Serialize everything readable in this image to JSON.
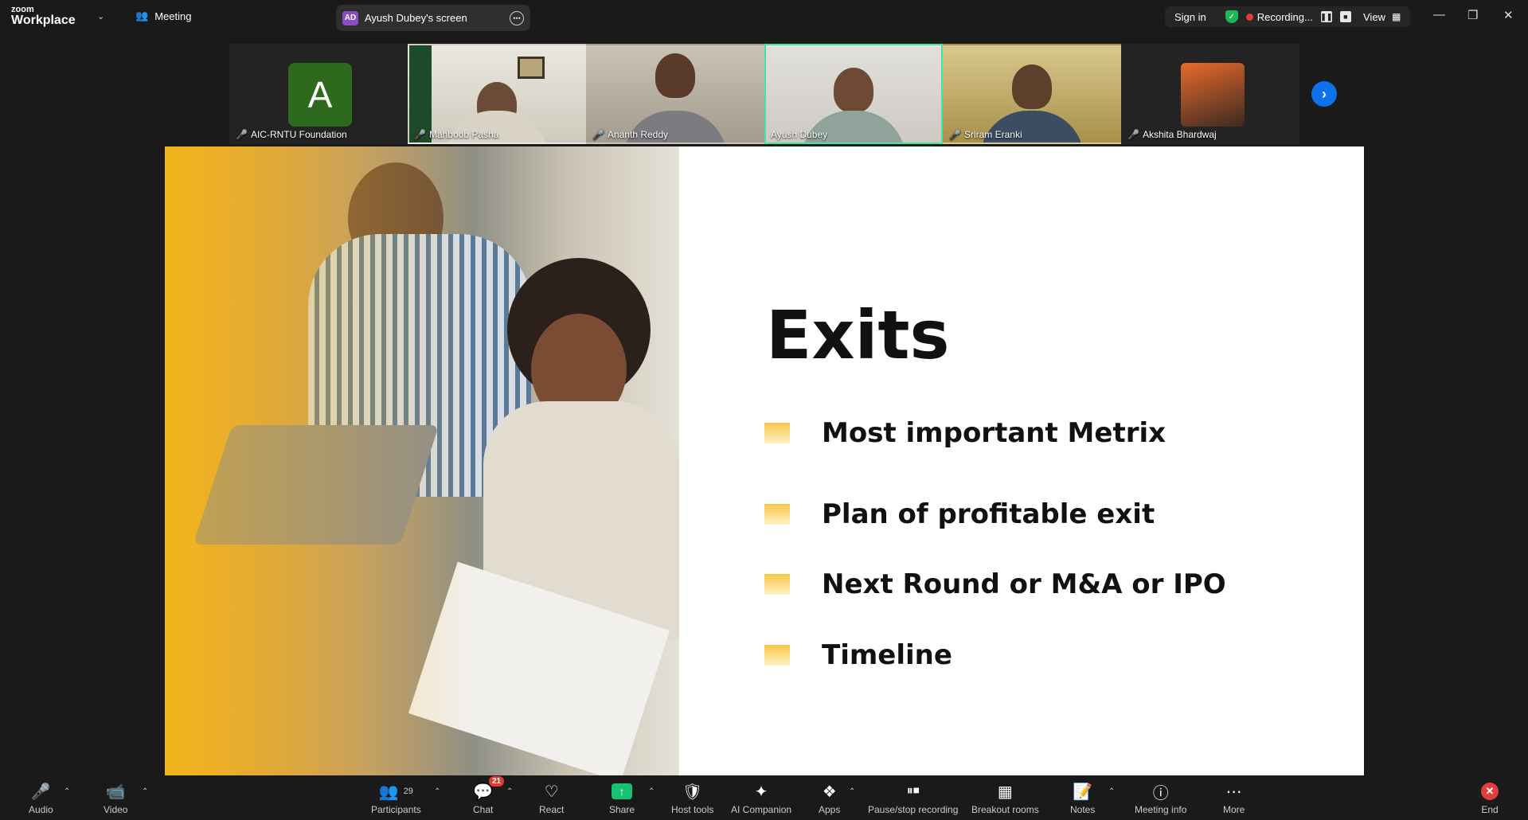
{
  "app": {
    "brand_line1": "zoom",
    "brand_line2": "Workplace",
    "meeting_tab": "Meeting",
    "screen_tab_badge": "AD",
    "screen_tab_label": "Ayush Dubey's screen",
    "sign_in": "Sign in",
    "recording_label": "Recording...",
    "view_label": "View"
  },
  "participants_strip": [
    {
      "name": "AIC-RNTU Foundation",
      "avatar_letter": "A",
      "muted": true,
      "active": false
    },
    {
      "name": "Mahboob Pasha",
      "muted": true,
      "active": false
    },
    {
      "name": "Ananth Reddy",
      "muted": true,
      "active": false
    },
    {
      "name": "Ayush Dubey",
      "muted": false,
      "active": true
    },
    {
      "name": "Sriram Eranki",
      "muted": true,
      "active": false
    },
    {
      "name": "Akshita Bhardwaj",
      "muted": true,
      "active": false
    }
  ],
  "slide": {
    "title": "Exits",
    "bullets": [
      "Most important Metrix",
      "Plan of profitable exit",
      "Next Round or M&A or IPO",
      "Timeline"
    ]
  },
  "toolbar": {
    "audio": "Audio",
    "video": "Video",
    "participants": "Participants",
    "participants_count": "29",
    "chat": "Chat",
    "chat_badge": "21",
    "react": "React",
    "share": "Share",
    "host_tools": "Host tools",
    "ai_companion": "AI Companion",
    "apps": "Apps",
    "pause_recording": "Pause/stop recording",
    "breakout_rooms": "Breakout rooms",
    "notes": "Notes",
    "meeting_info": "Meeting info",
    "more": "More",
    "end": "End"
  }
}
